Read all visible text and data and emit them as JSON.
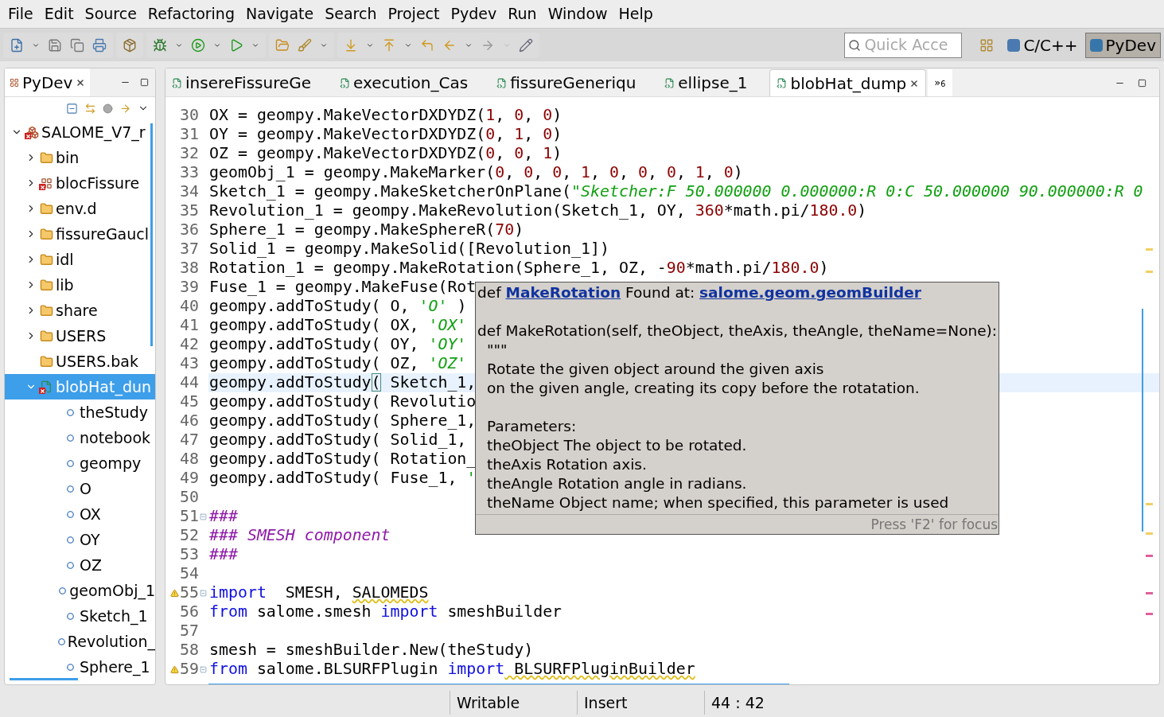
{
  "menu": [
    "File",
    "Edit",
    "Source",
    "Refactoring",
    "Navigate",
    "Search",
    "Project",
    "Pydev",
    "Run",
    "Window",
    "Help"
  ],
  "quick_access": {
    "placeholder": "Quick Acce"
  },
  "perspectives": [
    {
      "label": "C/C++",
      "selected": false
    },
    {
      "label": "PyDev",
      "selected": true
    }
  ],
  "explorer": {
    "title": "PyDev",
    "tree": [
      {
        "label": "SALOME_V7_r",
        "kind": "project",
        "error": true,
        "expanded": true,
        "selected": false,
        "children": [
          {
            "label": "bin",
            "kind": "folder",
            "error": false,
            "expanded": false,
            "selected": false
          },
          {
            "label": "blocFissure",
            "kind": "package",
            "error": true,
            "expanded": false,
            "selected": false
          },
          {
            "label": "env.d",
            "kind": "folder",
            "error": false,
            "expanded": false,
            "selected": false
          },
          {
            "label": "fissureGaucl",
            "kind": "folder",
            "error": false,
            "expanded": false,
            "selected": false
          },
          {
            "label": "idl",
            "kind": "folder",
            "error": false,
            "expanded": false,
            "selected": false
          },
          {
            "label": "lib",
            "kind": "folder",
            "error": false,
            "expanded": false,
            "selected": false
          },
          {
            "label": "share",
            "kind": "folder",
            "error": false,
            "expanded": false,
            "selected": false
          },
          {
            "label": "USERS",
            "kind": "folder",
            "error": false,
            "expanded": false,
            "selected": false
          },
          {
            "label": "USERS.bak",
            "kind": "folder",
            "error": false,
            "selected": false
          },
          {
            "label": "blobHat_dun",
            "kind": "module",
            "error": true,
            "expanded": true,
            "selected": true,
            "children": [
              {
                "label": "theStudy",
                "kind": "variable",
                "error": false,
                "selected": false
              },
              {
                "label": "notebook",
                "kind": "variable",
                "error": false,
                "selected": false
              },
              {
                "label": "geompy",
                "kind": "variable",
                "error": false,
                "selected": false
              },
              {
                "label": "O",
                "kind": "variable",
                "error": false,
                "selected": false
              },
              {
                "label": "OX",
                "kind": "variable",
                "error": false,
                "selected": false
              },
              {
                "label": "OY",
                "kind": "variable",
                "error": false,
                "selected": false
              },
              {
                "label": "OZ",
                "kind": "variable",
                "error": false,
                "selected": false
              },
              {
                "label": "geomObj_1",
                "kind": "variable",
                "error": false,
                "selected": false
              },
              {
                "label": "Sketch_1",
                "kind": "variable",
                "error": false,
                "selected": false
              },
              {
                "label": "Revolution_",
                "kind": "variable",
                "error": false,
                "selected": false
              },
              {
                "label": "Sphere_1",
                "kind": "variable",
                "error": false,
                "selected": false
              }
            ]
          }
        ]
      }
    ]
  },
  "editor_tabs": [
    {
      "label": "insereFissureGe",
      "selected": false
    },
    {
      "label": "execution_Cas",
      "selected": false
    },
    {
      "label": "fissureGeneriqu",
      "selected": false
    },
    {
      "label": "ellipse_1",
      "selected": false
    },
    {
      "label": "blobHat_dump",
      "selected": true
    }
  ],
  "tab_overflow": "»$_{6}$",
  "code": [
    {
      "number": "30",
      "current": false,
      "warning": false,
      "fold": false,
      "segments": [
        {
          "text": "OX = geompy.MakeVectorDXDYDZ(",
          "kind": "plain"
        },
        {
          "text": "1",
          "kind": "number"
        },
        {
          "text": ", ",
          "kind": "plain"
        },
        {
          "text": "0",
          "kind": "number"
        },
        {
          "text": ", ",
          "kind": "plain"
        },
        {
          "text": "0",
          "kind": "number"
        },
        {
          "text": ")",
          "kind": "plain"
        }
      ]
    },
    {
      "number": "31",
      "current": false,
      "warning": false,
      "fold": false,
      "segments": [
        {
          "text": "OY = geompy.MakeVectorDXDYDZ(",
          "kind": "plain"
        },
        {
          "text": "0",
          "kind": "number"
        },
        {
          "text": ", ",
          "kind": "plain"
        },
        {
          "text": "1",
          "kind": "number"
        },
        {
          "text": ", ",
          "kind": "plain"
        },
        {
          "text": "0",
          "kind": "number"
        },
        {
          "text": ")",
          "kind": "plain"
        }
      ]
    },
    {
      "number": "32",
      "current": false,
      "warning": false,
      "fold": false,
      "segments": [
        {
          "text": "OZ = geompy.MakeVectorDXDYDZ(",
          "kind": "plain"
        },
        {
          "text": "0",
          "kind": "number"
        },
        {
          "text": ", ",
          "kind": "plain"
        },
        {
          "text": "0",
          "kind": "number"
        },
        {
          "text": ", ",
          "kind": "plain"
        },
        {
          "text": "1",
          "kind": "number"
        },
        {
          "text": ")",
          "kind": "plain"
        }
      ]
    },
    {
      "number": "33",
      "current": false,
      "warning": false,
      "fold": false,
      "segments": [
        {
          "text": "geomObj_1 = geompy.MakeMarker(",
          "kind": "plain"
        },
        {
          "text": "0",
          "kind": "number"
        },
        {
          "text": ", ",
          "kind": "plain"
        },
        {
          "text": "0",
          "kind": "number"
        },
        {
          "text": ", ",
          "kind": "plain"
        },
        {
          "text": "0",
          "kind": "number"
        },
        {
          "text": ", ",
          "kind": "plain"
        },
        {
          "text": "1",
          "kind": "number"
        },
        {
          "text": ", ",
          "kind": "plain"
        },
        {
          "text": "0",
          "kind": "number"
        },
        {
          "text": ", ",
          "kind": "plain"
        },
        {
          "text": "0",
          "kind": "number"
        },
        {
          "text": ", ",
          "kind": "plain"
        },
        {
          "text": "0",
          "kind": "number"
        },
        {
          "text": ", ",
          "kind": "plain"
        },
        {
          "text": "1",
          "kind": "number"
        },
        {
          "text": ", ",
          "kind": "plain"
        },
        {
          "text": "0",
          "kind": "number"
        },
        {
          "text": ")",
          "kind": "plain"
        }
      ]
    },
    {
      "number": "34",
      "current": false,
      "warning": false,
      "fold": false,
      "segments": [
        {
          "text": "Sketch_1 = geompy.MakeSketcherOnPlane(",
          "kind": "plain"
        },
        {
          "text": "\"Sketcher:F 50.000000 0.000000:R 0:C 50.000000 90.000000:R 0",
          "kind": "string"
        }
      ]
    },
    {
      "number": "35",
      "current": false,
      "warning": false,
      "fold": false,
      "segments": [
        {
          "text": "Revolution_1 = geompy.MakeRevolution(Sketch_1, OY, ",
          "kind": "plain"
        },
        {
          "text": "360",
          "kind": "number"
        },
        {
          "text": "*math.pi/",
          "kind": "plain"
        },
        {
          "text": "180.0",
          "kind": "number"
        },
        {
          "text": ")",
          "kind": "plain"
        }
      ]
    },
    {
      "number": "36",
      "current": false,
      "warning": false,
      "fold": false,
      "segments": [
        {
          "text": "Sphere_1 = geompy.MakeSphereR(",
          "kind": "plain"
        },
        {
          "text": "70",
          "kind": "number"
        },
        {
          "text": ")",
          "kind": "plain"
        }
      ]
    },
    {
      "number": "37",
      "current": false,
      "warning": false,
      "fold": false,
      "segments": [
        {
          "text": "Solid_1 = geompy.MakeSolid([Revolution_1])",
          "kind": "plain"
        }
      ]
    },
    {
      "number": "38",
      "current": false,
      "warning": false,
      "fold": false,
      "segments": [
        {
          "text": "Rotation_1 = geompy.MakeRotation(Sphere_1, OZ, -",
          "kind": "plain"
        },
        {
          "text": "90",
          "kind": "number"
        },
        {
          "text": "*math.pi/",
          "kind": "plain"
        },
        {
          "text": "180.0",
          "kind": "number"
        },
        {
          "text": ")",
          "kind": "plain"
        }
      ]
    },
    {
      "number": "39",
      "current": false,
      "warning": false,
      "fold": false,
      "segments": [
        {
          "text": "Fuse_1 = geompy.MakeFuse(Rot",
          "kind": "plain"
        }
      ]
    },
    {
      "number": "40",
      "current": false,
      "warning": false,
      "fold": false,
      "segments": [
        {
          "text": "geompy.addToStudy( O, ",
          "kind": "plain"
        },
        {
          "text": "'O'",
          "kind": "string"
        },
        {
          "text": " )",
          "kind": "plain"
        }
      ]
    },
    {
      "number": "41",
      "current": false,
      "warning": false,
      "fold": false,
      "segments": [
        {
          "text": "geompy.addToStudy( OX, ",
          "kind": "plain"
        },
        {
          "text": "'OX'",
          "kind": "string"
        }
      ]
    },
    {
      "number": "42",
      "current": false,
      "warning": false,
      "fold": false,
      "segments": [
        {
          "text": "geompy.addToStudy( OY, ",
          "kind": "plain"
        },
        {
          "text": "'OY'",
          "kind": "string"
        }
      ]
    },
    {
      "number": "43",
      "current": false,
      "warning": false,
      "fold": false,
      "segments": [
        {
          "text": "geompy.addToStudy( OZ, ",
          "kind": "plain"
        },
        {
          "text": "'OZ'",
          "kind": "string"
        }
      ]
    },
    {
      "number": "44",
      "current": true,
      "warning": false,
      "fold": false,
      "segments": [
        {
          "text": "geompy.addToStudy",
          "kind": "plain"
        },
        {
          "text": "(",
          "kind": "bracket"
        },
        {
          "text": " Sketch_1,",
          "kind": "plain"
        }
      ]
    },
    {
      "number": "45",
      "current": false,
      "warning": false,
      "fold": false,
      "segments": [
        {
          "text": "geompy.addToStudy( Revolutio",
          "kind": "plain"
        }
      ]
    },
    {
      "number": "46",
      "current": false,
      "warning": false,
      "fold": false,
      "segments": [
        {
          "text": "geompy.addToStudy( Sphere_1,",
          "kind": "plain"
        }
      ]
    },
    {
      "number": "47",
      "current": false,
      "warning": false,
      "fold": false,
      "segments": [
        {
          "text": "geompy.addToStudy( Solid_1,",
          "kind": "plain"
        }
      ]
    },
    {
      "number": "48",
      "current": false,
      "warning": false,
      "fold": false,
      "segments": [
        {
          "text": "geompy.addToStudy( Rotation_",
          "kind": "plain"
        }
      ]
    },
    {
      "number": "49",
      "current": false,
      "warning": false,
      "fold": false,
      "segments": [
        {
          "text": "geompy.addToStudy( Fuse_1, ",
          "kind": "plain"
        },
        {
          "text": "'",
          "kind": "string"
        }
      ]
    },
    {
      "number": "50",
      "current": false,
      "warning": false,
      "fold": false
    },
    {
      "number": "51",
      "current": false,
      "warning": false,
      "fold": true,
      "segments": [
        {
          "text": "###",
          "kind": "comment"
        }
      ]
    },
    {
      "number": "52",
      "current": false,
      "warning": false,
      "fold": false,
      "segments": [
        {
          "text": "### SMESH component",
          "kind": "comment"
        }
      ]
    },
    {
      "number": "53",
      "current": false,
      "warning": false,
      "fold": false,
      "segments": [
        {
          "text": "###",
          "kind": "comment"
        }
      ]
    },
    {
      "number": "54",
      "current": false,
      "warning": false,
      "fold": false
    },
    {
      "number": "55",
      "current": false,
      "warning": true,
      "fold": true,
      "segments": [
        {
          "text": "import",
          "kind": "keyword"
        },
        {
          "text": "  SMESH, ",
          "kind": "plain"
        },
        {
          "text": "SALOMEDS",
          "kind": "warned"
        }
      ]
    },
    {
      "number": "56",
      "current": false,
      "warning": false,
      "fold": false,
      "segments": [
        {
          "text": "from",
          "kind": "keyword"
        },
        {
          "text": " salome.smesh ",
          "kind": "plain"
        },
        {
          "text": "import",
          "kind": "keyword"
        },
        {
          "text": " smeshBuilder",
          "kind": "plain"
        }
      ]
    },
    {
      "number": "57",
      "current": false,
      "warning": false,
      "fold": false
    },
    {
      "number": "58",
      "current": false,
      "warning": false,
      "fold": false,
      "segments": [
        {
          "text": "smesh = smeshBuilder.New(theStudy)",
          "kind": "plain"
        }
      ]
    },
    {
      "number": "59",
      "current": false,
      "warning": true,
      "fold": true,
      "segments": [
        {
          "text": "from",
          "kind": "keyword"
        },
        {
          "text": " salome.BLSURFPlugin ",
          "kind": "plain"
        },
        {
          "text": "import",
          "kind": "keyword"
        },
        {
          "text": " BLSURFPluginBuilder",
          "kind": "warned"
        }
      ]
    }
  ],
  "hover": {
    "header": [
      {
        "text": "def ",
        "kind": "plain"
      },
      {
        "text": "MakeRotation",
        "kind": "link"
      },
      {
        "text": " Found at: ",
        "kind": "plain"
      },
      {
        "text": "salome.geom.geomBuilder",
        "kind": "link"
      }
    ],
    "signature": "def MakeRotation(self, theObject, theAxis, theAngle, theName=None):",
    "paragraphs": [
      [
        "\"\"\"",
        "Rotate the given object around the given axis",
        "on the given angle, creating its copy before the rotatation."
      ],
      [
        "Parameters:",
        "theObject The object to be rotated.",
        "theAxis Rotation axis.",
        "theAngle Rotation angle in radians.",
        "theName Object name; when specified, this parameter is used"
      ]
    ],
    "footer": "Press 'F2' for focus"
  },
  "status_bar": [
    "Writable",
    "Insert",
    "44 : 42"
  ]
}
